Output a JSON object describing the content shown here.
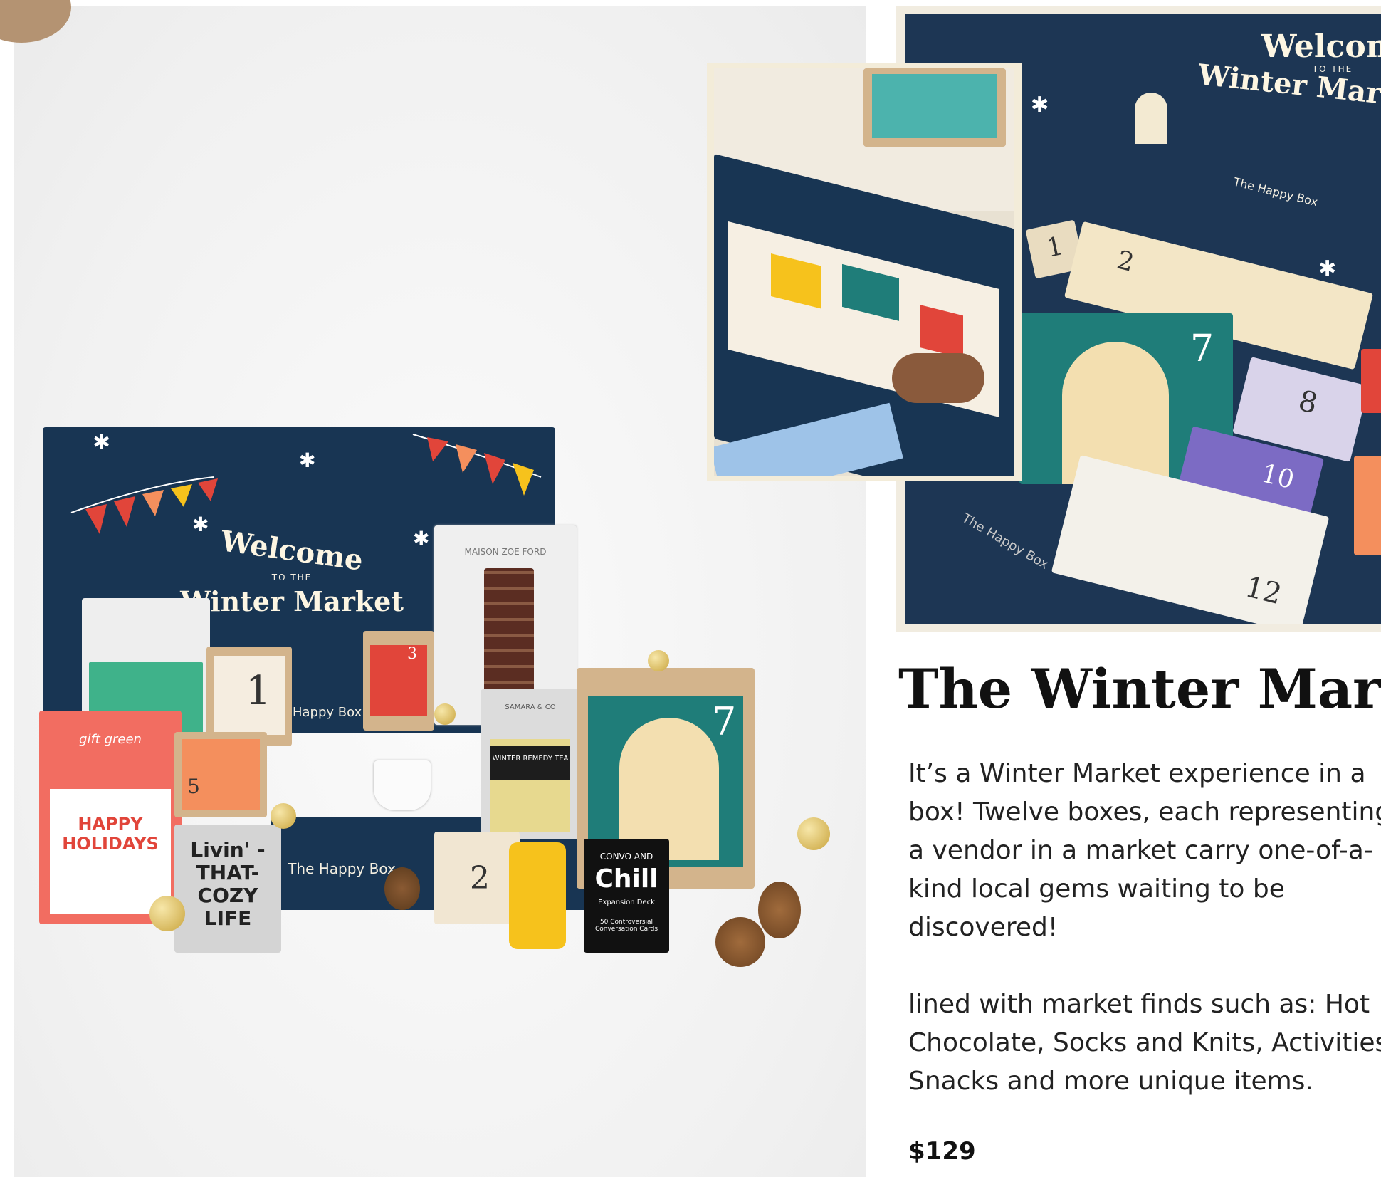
{
  "product": {
    "title": "The Winter Market",
    "description": "It’s a Winter Market experience in a box! Twelve boxes, each representing a vendor in a market carry one-of-a-kind local gems waiting to be discovered!",
    "details": "lined with market finds such as: Hot Chocolate, Socks and Knits, Activities, Snacks and more unique items.",
    "price": "$129"
  },
  "box_lid": {
    "welcome": "Welcome",
    "to_the": "TO THE",
    "market": "Winter Market",
    "brand": "The Happy Box"
  },
  "packaging_labels": {
    "box_number_1": "1",
    "box_number_2": "2",
    "box_number_3": "3",
    "box_number_5": "5",
    "box_number_7": "7",
    "box_number_8": "8",
    "box_number_10": "10",
    "box_number_12": "12",
    "socks": "Livin' -THAT- COZY LIFE",
    "holidays": "HAPPY HOLIDAYS",
    "gift_green": "gift green",
    "tea_brand": "SAMARA & CO",
    "tea_name": "WINTER REMEDY TEA",
    "cards_top": "CONVO AND",
    "cards_name": "Chill",
    "cards_sub": "Expansion Deck",
    "cards_bottom": "50 Controversial Conversation Cards",
    "bag_brand": "MAISON ZOE FORD"
  },
  "colors": {
    "navy": "#183553",
    "kraft": "#d3b48c",
    "accent_red": "#e1453a",
    "accent_yellow": "#f6c21c"
  }
}
